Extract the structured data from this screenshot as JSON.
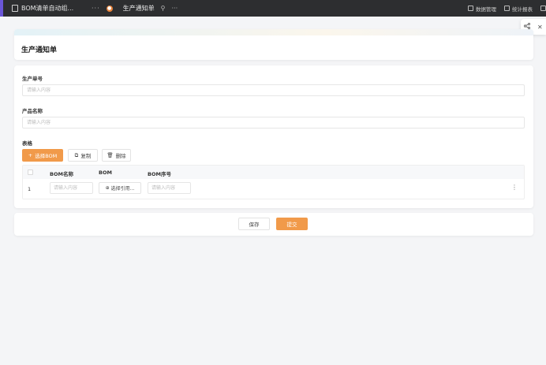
{
  "topbar": {
    "tab1_label": "BOM清单自动组...",
    "more_glyph": "···",
    "tab2_label": "生产通知单",
    "tab2_more": "···",
    "data_manage": "数据管理",
    "stats_report": "统计报表"
  },
  "page": {
    "title": "生产通知单"
  },
  "form": {
    "order_no_label": "生产单号",
    "order_no_placeholder": "请输入内容",
    "product_name_label": "产品名称",
    "product_name_placeholder": "请输入内容",
    "table_label": "表格"
  },
  "table_toolbar": {
    "select_bom": "选择BOM",
    "copy": "复制",
    "delete": "删除"
  },
  "table": {
    "columns": [
      "BOM名称",
      "BOM",
      "BOM序号"
    ],
    "rows": [
      {
        "index": "1",
        "bom_name_placeholder": "请输入内容",
        "bom_button": "选择引用...",
        "bom_seq_placeholder": "请输入内容"
      }
    ]
  },
  "footer": {
    "save": "保存",
    "submit": "提交"
  },
  "colors": {
    "primary": "#f19a4a",
    "topbar": "#2d2e30"
  }
}
